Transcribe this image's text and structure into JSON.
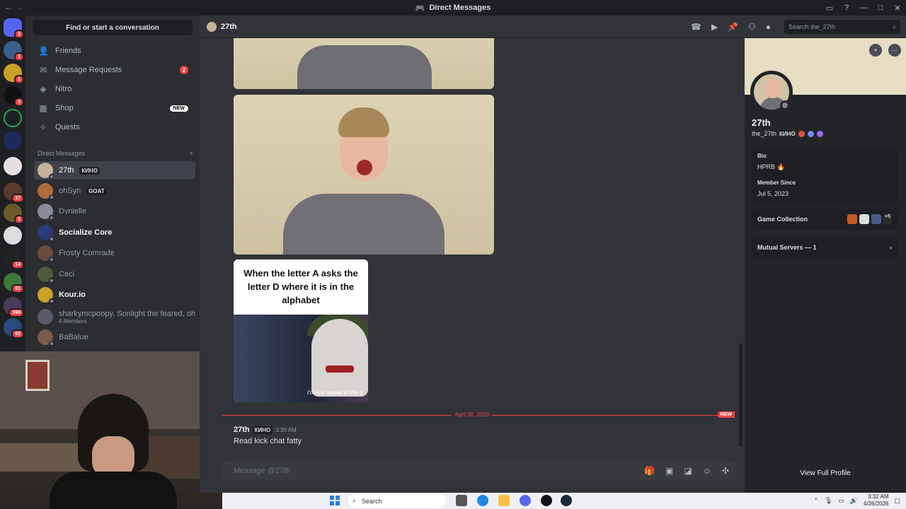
{
  "window": {
    "title": "Direct Messages"
  },
  "sidebar": {
    "find_label": "Find or start a conversation",
    "nav": [
      {
        "label": "Friends",
        "icon": "friends-icon"
      },
      {
        "label": "Message Requests",
        "icon": "mail-icon",
        "badge": "2"
      },
      {
        "label": "Nitro",
        "icon": "nitro-icon"
      },
      {
        "label": "Shop",
        "icon": "shop-icon",
        "badge": "NEW"
      },
      {
        "label": "Quests",
        "icon": "quests-icon"
      }
    ],
    "dm_header": "Direct Messages",
    "dms": [
      {
        "name": "27th",
        "tag": "КИНО"
      },
      {
        "name": "ohSyn",
        "tag": "GOAT"
      },
      {
        "name": "Dvnielle"
      },
      {
        "name": "Socialize Core"
      },
      {
        "name": "Frosty Comrade"
      },
      {
        "name": "Ceci"
      },
      {
        "name": "Kour.io"
      },
      {
        "name": "sharkymcpoopy, Sonlight the feared, oh...",
        "sub": "4 Members"
      },
      {
        "name": "BaBalue"
      }
    ],
    "server_badges": [
      "2",
      "1",
      "1",
      "3",
      "17",
      "1",
      "14",
      "81",
      "399",
      "62"
    ]
  },
  "chat": {
    "channel_name": "27th",
    "search_placeholder": "Search the_27th",
    "meme_caption": "When the letter A asks the letter D where it is in the alphabet",
    "meme_subtitle": "I'm just ahead of the c",
    "divider_date": "April 26, 2026",
    "divider_new": "NEW",
    "message": {
      "author": "27th",
      "tag": "КИНО",
      "time": "3:30 AM",
      "text": "Read kick chat fatty"
    },
    "composer_placeholder": "Message @27th"
  },
  "profile": {
    "display_name": "27th",
    "username": "the_27th",
    "tag": "КИНО",
    "bio_label": "Bio",
    "bio": "HPRB 🔥",
    "member_since_label": "Member Since",
    "member_since": "Jul 5, 2023",
    "game_collection_label": "Game Collection",
    "game_more": "+5",
    "mutual_servers": "Mutual Servers — 1",
    "view_full": "View Full Profile"
  },
  "taskbar": {
    "search_label": "Search",
    "time": "3:32 AM",
    "date": "4/26/2026"
  },
  "colors": {
    "accent": "#5865f2",
    "danger": "#f23f43",
    "bg": "#313338",
    "sidebar": "#2b2d31"
  }
}
